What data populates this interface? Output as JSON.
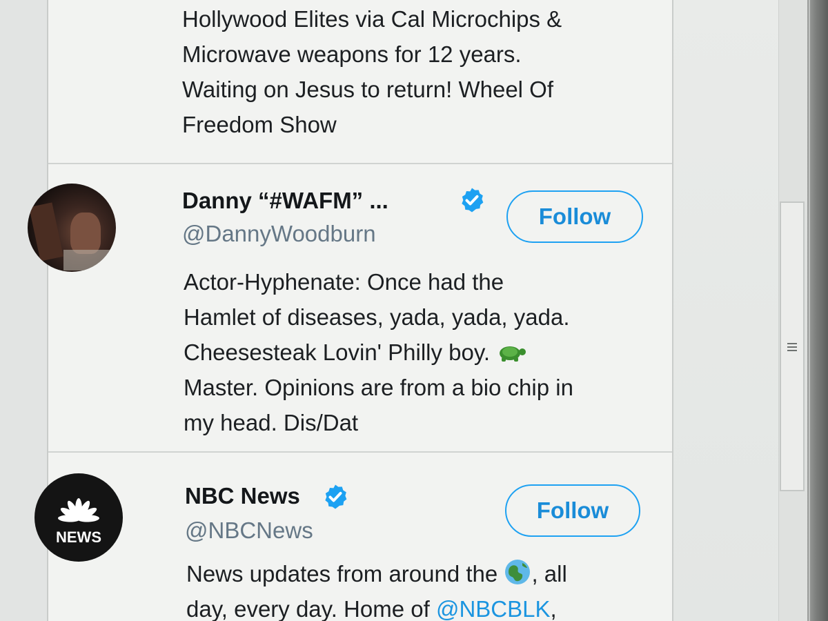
{
  "previous_card": {
    "bio_lines": [
      "Hollywood Elites via Cal Microchips &",
      "Microwave weapons for 12 years.",
      "Waiting on Jesus to return! Wheel Of",
      "Freedom Show"
    ]
  },
  "accounts": [
    {
      "name": "Danny “#WAFM” ...",
      "handle": "@DannyWoodburn",
      "verified": true,
      "follow_label": "Follow",
      "bio_lines": [
        "Actor-Hyphenate: Once had the",
        "Hamlet of diseases, yada, yada, yada.",
        "Cheesesteak Lovin' Philly boy.",
        "Master. Opinions are from a bio chip in",
        "my head. Dis/Dat"
      ],
      "bio_emoji": "turtle-emoji"
    },
    {
      "name": "NBC News",
      "handle": "@NBCNews",
      "verified": true,
      "follow_label": "Follow",
      "bio_line1_pre": "News updates from around the",
      "bio_line1_post": ", all",
      "bio_emoji": "globe-emoji",
      "bio_line2_pre": "day, every day. Home of",
      "bio_line2_link": "@NBCBLK",
      "bio_line2_post": ",",
      "avatar_logo_text": "NEWS"
    }
  ],
  "colors": {
    "accent": "#1da1f2",
    "name_text": "#14171a",
    "handle_text": "#657786",
    "panel_bg": "#f2f3f1"
  },
  "icons": {
    "verified": "verified-badge-icon",
    "scroll_grip": "scrollbar-grip-icon"
  }
}
